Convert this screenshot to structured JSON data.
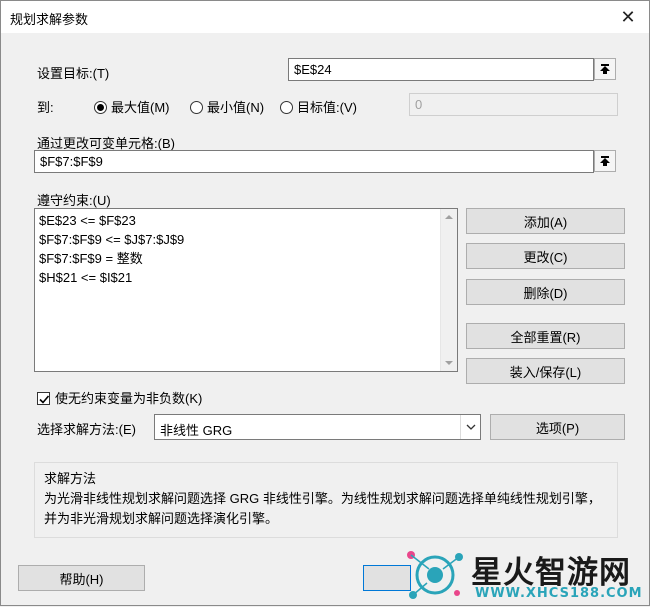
{
  "window": {
    "title": "规划求解参数",
    "close_glyph": "✕"
  },
  "objective": {
    "label": "设置目标:(T)",
    "value": "$E$24"
  },
  "to": {
    "label": "到:",
    "options": [
      {
        "label": "最大值(M)",
        "selected": true
      },
      {
        "label": "最小值(N)",
        "selected": false
      },
      {
        "label": "目标值:(V)",
        "selected": false
      }
    ],
    "target_value": "0"
  },
  "variables": {
    "label": "通过更改可变单元格:(B)",
    "value": "$F$7:$F$9"
  },
  "constraints": {
    "label": "遵守约束:(U)",
    "items": [
      "$E$23 <= $F$23",
      "$F$7:$F$9 <= $J$7:$J$9",
      "$F$7:$F$9 = 整数",
      "$H$21 <= $I$21"
    ]
  },
  "buttons": {
    "add": "添加(A)",
    "change": "更改(C)",
    "delete": "删除(D)",
    "reset_all": "全部重置(R)",
    "load_save": "装入/保存(L)",
    "options": "选项(P)",
    "help": "帮助(H)",
    "solve": ""
  },
  "nonnegative": {
    "label": "使无约束变量为非负数(K)",
    "checked": true
  },
  "method": {
    "label": "选择求解方法:(E)",
    "value": "非线性 GRG"
  },
  "solving_method": {
    "title": "求解方法",
    "description": "为光滑非线性规划求解问题选择 GRG 非线性引擎。为线性规划求解问题选择单纯线性规划引擎，并为非光滑规划求解问题选择演化引擎。"
  },
  "watermark": {
    "brand": "星火智游网",
    "url": "WWW.XHCS188.COM"
  },
  "colors": {
    "accent": "#0078d7",
    "watermark_teal": "#2aa4b9"
  }
}
